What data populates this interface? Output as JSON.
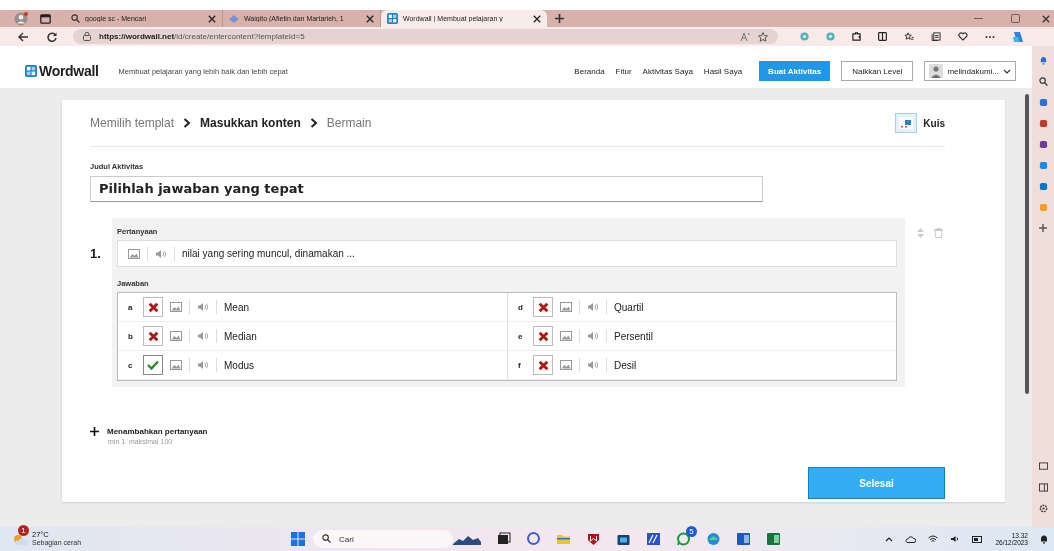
{
  "browser": {
    "tabs": [
      {
        "title": "google sc - Mencari",
        "selected": false,
        "kind": "search"
      },
      {
        "title": "Waigito (Afietin dan Martarieh, 1",
        "selected": false,
        "kind": "diamond"
      },
      {
        "title": "Wordwall | Membuat pelajaran y",
        "selected": true,
        "kind": "grid"
      }
    ],
    "url_host": "https://wordwall.net",
    "url_path": "/id/create/entercontent?templateId=5"
  },
  "header": {
    "logo": "Wordwall",
    "tagline": "Membuat pelajaran yang lebih baik dan lebih cepat",
    "nav": [
      {
        "label": "Beranda"
      },
      {
        "label": "Fitur"
      },
      {
        "label": "Aktivitas Saya"
      },
      {
        "label": "Hasil Saya"
      }
    ],
    "create_button": "Buat Aktivitas",
    "upgrade_button": "Naikkan Level",
    "user": "melindakumi..."
  },
  "editor": {
    "steps": [
      {
        "label": "Memilih templat",
        "selected": false
      },
      {
        "label": "Masukkan konten",
        "selected": true
      },
      {
        "label": "Bermain",
        "selected": false
      }
    ],
    "template": "Kuis",
    "title_label": "Judul Aktivitas",
    "title_value": "Pilihlah jawaban yang tepat",
    "questions": [
      {
        "number": "1.",
        "question_label": "Pertanyaan",
        "question": "nilai yang sering muncul, dinamakan ...",
        "answers_label": "Jawaban",
        "answers": [
          {
            "letter": "a",
            "text": "Mean",
            "correct": false
          },
          {
            "letter": "b",
            "text": "Median",
            "correct": false
          },
          {
            "letter": "c",
            "text": "Modus",
            "correct": true
          },
          {
            "letter": "d",
            "text": "Quartil",
            "correct": false
          },
          {
            "letter": "e",
            "text": "Persentil",
            "correct": false
          },
          {
            "letter": "f",
            "text": "Desil",
            "correct": false
          }
        ]
      }
    ],
    "add_question": "Menambahkan pertanyaan",
    "limit_hint": "min 1  maksimal 100",
    "done_button": "Selesai"
  },
  "taskbar": {
    "weather_badge": "1",
    "temperature": "27°C",
    "weather": "Sebagian cerah",
    "search_placeholder": "Cari",
    "chat_badge": "5",
    "time": "13.32",
    "date": "26/12/2023"
  }
}
